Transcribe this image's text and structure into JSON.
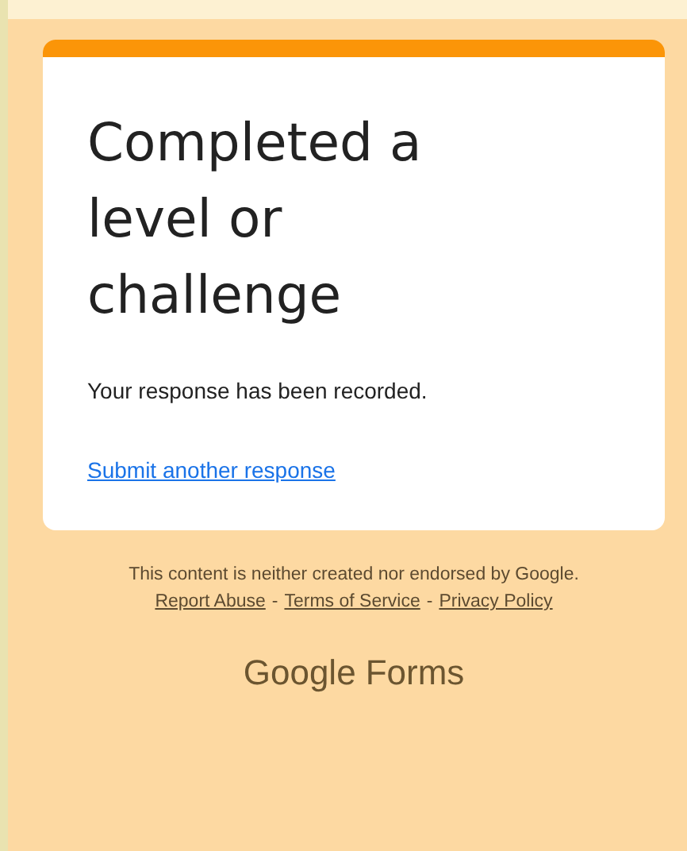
{
  "card": {
    "title": "Completed a level or challenge",
    "message": "Your response has been recorded.",
    "link": "Submit another response"
  },
  "footer": {
    "disclaimer": "This content is neither created nor endorsed by Google.",
    "links": [
      {
        "kind": "link",
        "text": "Report Abuse"
      },
      {
        "kind": "separator",
        "text": "-"
      },
      {
        "kind": "link",
        "text": "Terms of Service"
      },
      {
        "kind": "separator",
        "text": "-"
      },
      {
        "kind": "link",
        "text": "Privacy Policy"
      }
    ]
  },
  "brand": {
    "primary": "Google",
    "secondary": "Forms"
  }
}
